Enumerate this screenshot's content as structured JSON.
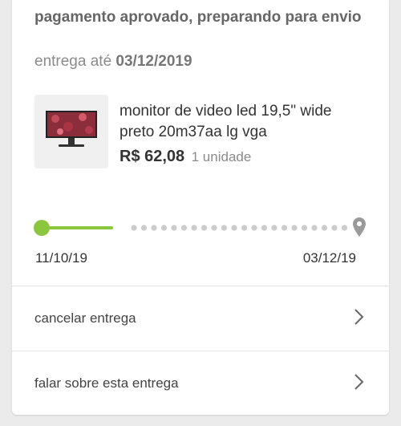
{
  "order": {
    "status_title": "pagamento aprovado, preparando para envio",
    "delivery_prefix": "entrega até",
    "delivery_date": "03/12/2019"
  },
  "product": {
    "name": "monitor de video led 19,5\" wide preto 20m37aa lg vga",
    "price": "R$ 62,08",
    "quantity": "1 unidade"
  },
  "tracking": {
    "start_date": "11/10/19",
    "end_date": "03/12/19",
    "progress_color": "#8cc63f",
    "pending_color": "#cccccc",
    "destination_icon": "location-pin-icon"
  },
  "actions": [
    {
      "label": "cancelar entrega",
      "icon": "chevron-right-icon"
    },
    {
      "label": "falar sobre esta entrega",
      "icon": "chevron-right-icon"
    }
  ]
}
